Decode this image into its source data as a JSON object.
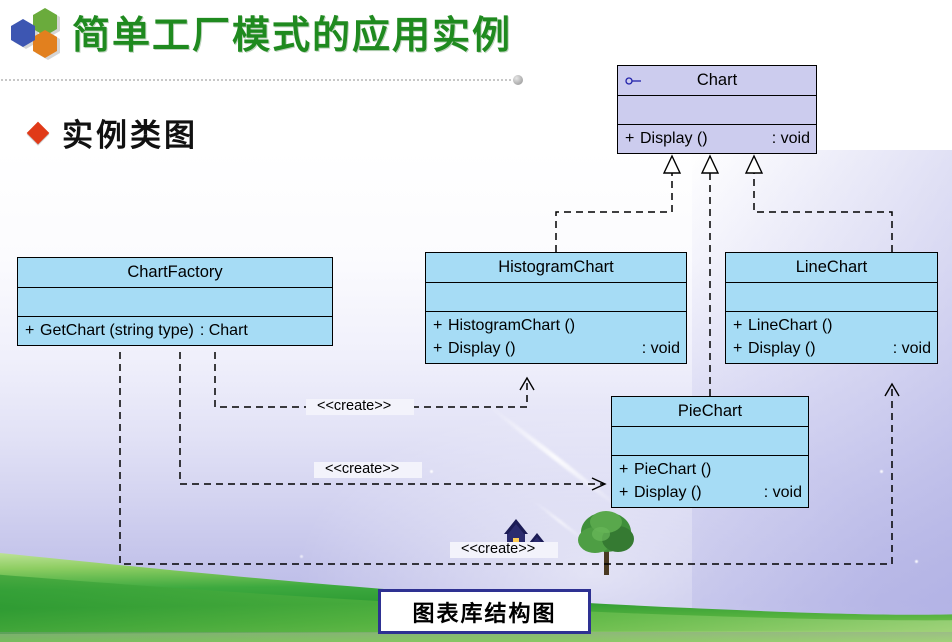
{
  "header": {
    "title": "简单工厂模式的应用实例",
    "title_color": "#1f8a1f",
    "logo_name": "hexagon-logo",
    "logo_colors": [
      "#3d56b2",
      "#6aab3c",
      "#e2801e"
    ],
    "bullet": {
      "marker_color": "#e03a18",
      "text": "实例类图"
    }
  },
  "diagram": {
    "caption": "图表库结构图",
    "caption_border_color": "#2e3192",
    "interface_fill": "#ccccee",
    "class_fill": "#a6dcf5",
    "classes": [
      {
        "id": "chart",
        "name": "Chart",
        "stereotype_icon": "interface-lollipop-icon",
        "is_interface": true,
        "attributes": [],
        "operations": [
          {
            "visibility": "+",
            "signature": "Display ()",
            "return": ": void"
          }
        ]
      },
      {
        "id": "chartfactory",
        "name": "ChartFactory",
        "is_interface": false,
        "attributes": [],
        "operations": [
          {
            "visibility": "+",
            "signature": "GetChart (string type)",
            "return": ": Chart"
          }
        ]
      },
      {
        "id": "histogramchart",
        "name": "HistogramChart",
        "is_interface": false,
        "attributes": [],
        "operations": [
          {
            "visibility": "+",
            "signature": "HistogramChart ()",
            "return": ""
          },
          {
            "visibility": "+",
            "signature": "Display ()",
            "return": ": void"
          }
        ]
      },
      {
        "id": "linechart",
        "name": "LineChart",
        "is_interface": false,
        "attributes": [],
        "operations": [
          {
            "visibility": "+",
            "signature": "LineChart ()",
            "return": ""
          },
          {
            "visibility": "+",
            "signature": "Display ()",
            "return": ": void"
          }
        ]
      },
      {
        "id": "piechart",
        "name": "PieChart",
        "is_interface": false,
        "attributes": [],
        "operations": [
          {
            "visibility": "+",
            "signature": "PieChart ()",
            "return": ""
          },
          {
            "visibility": "+",
            "signature": "Display ()",
            "return": ": void"
          }
        ]
      }
    ],
    "relations": [
      {
        "kind": "realization",
        "from": "HistogramChart",
        "to": "Chart",
        "label": ""
      },
      {
        "kind": "realization",
        "from": "PieChart",
        "to": "Chart",
        "label": ""
      },
      {
        "kind": "realization",
        "from": "LineChart",
        "to": "Chart",
        "label": ""
      },
      {
        "kind": "dependency",
        "from": "ChartFactory",
        "to": "HistogramChart",
        "label": "<<create>>"
      },
      {
        "kind": "dependency",
        "from": "ChartFactory",
        "to": "PieChart",
        "label": "<<create>>"
      },
      {
        "kind": "dependency",
        "from": "ChartFactory",
        "to": "LineChart",
        "label": "<<create>>"
      }
    ]
  }
}
